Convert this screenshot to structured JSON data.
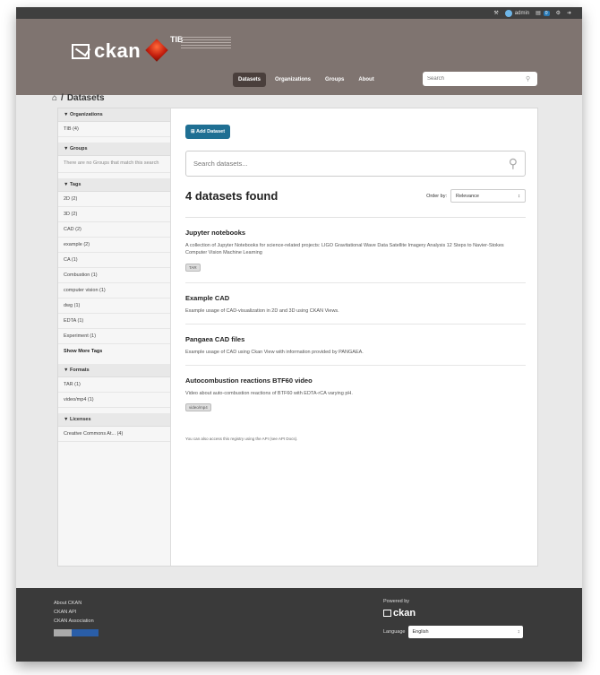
{
  "account": {
    "username": "admin",
    "dashboard_count": "0"
  },
  "brand": {
    "name": "ckan",
    "partner": "TIB"
  },
  "nav": {
    "tabs": [
      "Datasets",
      "Organizations",
      "Groups",
      "About"
    ],
    "search_placeholder": "Search"
  },
  "breadcrumb": {
    "current": "Datasets"
  },
  "sidebar": {
    "organizations": {
      "title": "Organizations",
      "items": [
        "TIB (4)"
      ]
    },
    "groups": {
      "title": "Groups",
      "empty": "There are no Groups that match this search"
    },
    "tags": {
      "title": "Tags",
      "items": [
        "2D (2)",
        "3D (2)",
        "CAD (2)",
        "example (2)",
        "CA (1)",
        "Combustion (1)",
        "computer vision (1)",
        "dwg (1)",
        "EDTA (1)",
        "Experiment (1)"
      ],
      "more": "Show More Tags"
    },
    "formats": {
      "title": "Formats",
      "items": [
        "TAR (1)",
        "video/mp4 (1)"
      ]
    },
    "licenses": {
      "title": "Licenses",
      "items": [
        "Creative Commons At... (4)"
      ]
    }
  },
  "main": {
    "add_button": "Add Dataset",
    "search_placeholder": "Search datasets...",
    "results_count": "4 datasets found",
    "order_label": "Order by:",
    "order_value": "Relevance",
    "datasets": [
      {
        "title": "Jupyter notebooks",
        "notes": "A collection of Jupyter Notebooks for science-related projects: LIGO Gravitational Wave Data Satellite Imagery Analysis 12 Steps to Navier-Stokes Computer Vision Machine Learning",
        "format": "TAR"
      },
      {
        "title": "Example CAD",
        "notes": "Example usage of CAD-visualization in 2D and 3D using CKAN Views."
      },
      {
        "title": "Pangaea CAD files",
        "notes": "Example usage of CAD using Ckan View with information provided by PANGAEA."
      },
      {
        "title": "Autocombustion reactions BTF60 video",
        "notes": "Video about auto-combustion reactions of BTF60 with EDTA-rCA varying pH.",
        "format": "video/mp4"
      }
    ],
    "api_note": "You can also access this registry using the API (see API Docs)."
  },
  "footer": {
    "links": [
      "About CKAN",
      "CKAN API",
      "CKAN Association"
    ],
    "powered_by": "Powered by",
    "powered_logo": "ckan",
    "language_label": "Language",
    "language_value": "English"
  }
}
